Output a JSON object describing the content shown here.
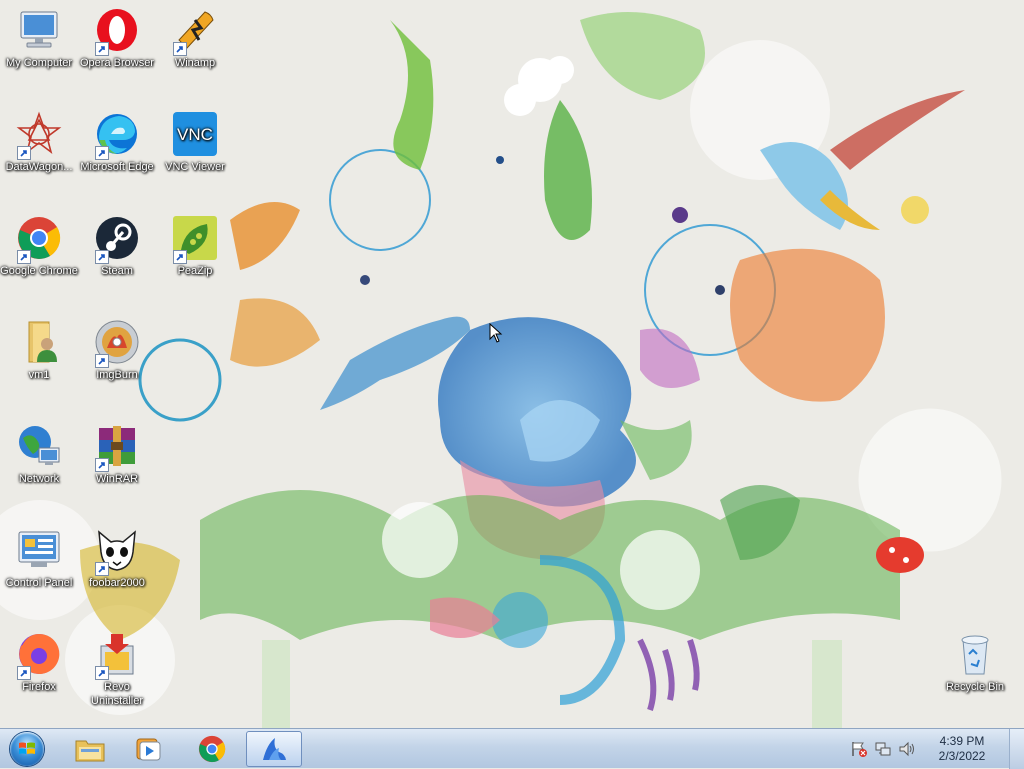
{
  "desktop": {
    "icons": [
      {
        "label": "My Computer",
        "icon": "computer-icon"
      },
      {
        "label": "Opera Browser",
        "icon": "opera-icon"
      },
      {
        "label": "Winamp",
        "icon": "winamp-icon"
      },
      {
        "label": "DataWagon...",
        "icon": "datawagon-icon"
      },
      {
        "label": "Microsoft Edge",
        "icon": "edge-icon"
      },
      {
        "label": "VNC Viewer",
        "icon": "vnc-icon"
      },
      {
        "label": "Google Chrome",
        "icon": "chrome-icon"
      },
      {
        "label": "Steam",
        "icon": "steam-icon"
      },
      {
        "label": "PeaZip",
        "icon": "peazip-icon"
      },
      {
        "label": "vm1",
        "icon": "user-folder-icon"
      },
      {
        "label": "ImgBurn",
        "icon": "imgburn-icon"
      },
      {
        "label": "Network",
        "icon": "network-icon"
      },
      {
        "label": "WinRAR",
        "icon": "winrar-icon"
      },
      {
        "label": "Control Panel",
        "icon": "control-panel-icon"
      },
      {
        "label": "foobar2000",
        "icon": "foobar-icon"
      },
      {
        "label": "Firefox",
        "icon": "firefox-icon"
      },
      {
        "label": "Revo Uninstaller",
        "icon": "revo-icon"
      },
      {
        "label": "Recycle Bin",
        "icon": "recycle-bin-icon"
      }
    ]
  },
  "taskbar": {
    "pinned": [
      {
        "name": "windows-explorer",
        "icon": "folder-icon"
      },
      {
        "name": "media-player",
        "icon": "media-player-icon"
      },
      {
        "name": "chrome",
        "icon": "chrome-icon"
      },
      {
        "name": "active-app",
        "icon": "bird-icon"
      }
    ],
    "tray": {
      "time": "4:39 PM",
      "date": "2/3/2022"
    }
  },
  "colors": {
    "taskbar_top": "#dfe9f5",
    "taskbar_bottom": "#b2c7e0",
    "desktop_bg": "#ecebe6"
  }
}
